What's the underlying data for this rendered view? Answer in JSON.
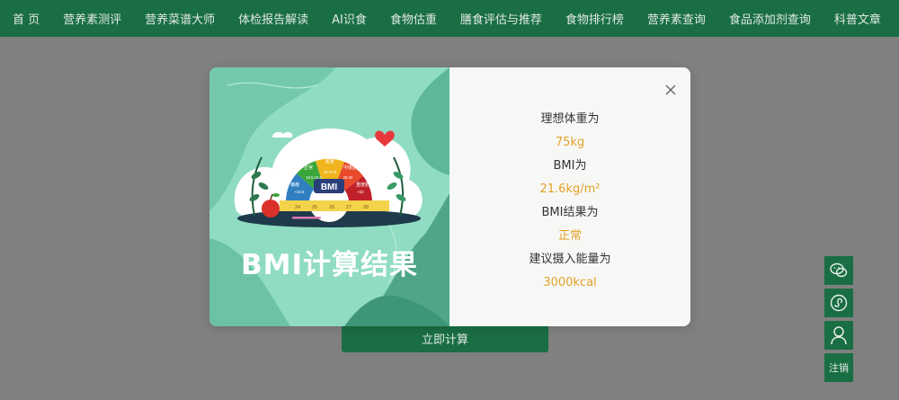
{
  "nav": {
    "items": [
      "首 页",
      "营养素测评",
      "营养菜谱大师",
      "体检报告解读",
      "AI识食",
      "食物估重",
      "膳食评估与推荐",
      "食物排行榜",
      "营养素查询",
      "食品添加剂查询",
      "科普文章"
    ]
  },
  "main": {
    "calc_button": "立即计算"
  },
  "modal": {
    "art_title": "BMI计算结果",
    "gauge_badge": "BMI",
    "gauge_segments": [
      "偏瘦",
      "正常",
      "超重",
      "中度肥胖",
      "重度肥胖"
    ],
    "gauge_ranges": [
      "<18.5",
      "18.5-23.9",
      "24-27.9",
      "28-32",
      ">32"
    ],
    "ruler_ticks": [
      "24",
      "25",
      "26",
      "27",
      "28"
    ],
    "results": [
      {
        "label": "理想体重为",
        "value": "75kg"
      },
      {
        "label": "BMI为",
        "value": "21.6kg/m²"
      },
      {
        "label": "BMI结果为",
        "value": "正常"
      },
      {
        "label": "建议摄入能量为",
        "value": "3000kcal"
      }
    ]
  },
  "float_bar": {
    "logout_label": "注销"
  },
  "colors": {
    "brand_green": "#1a6e44",
    "accent_orange": "#e3a126",
    "overlay": "#808080"
  }
}
